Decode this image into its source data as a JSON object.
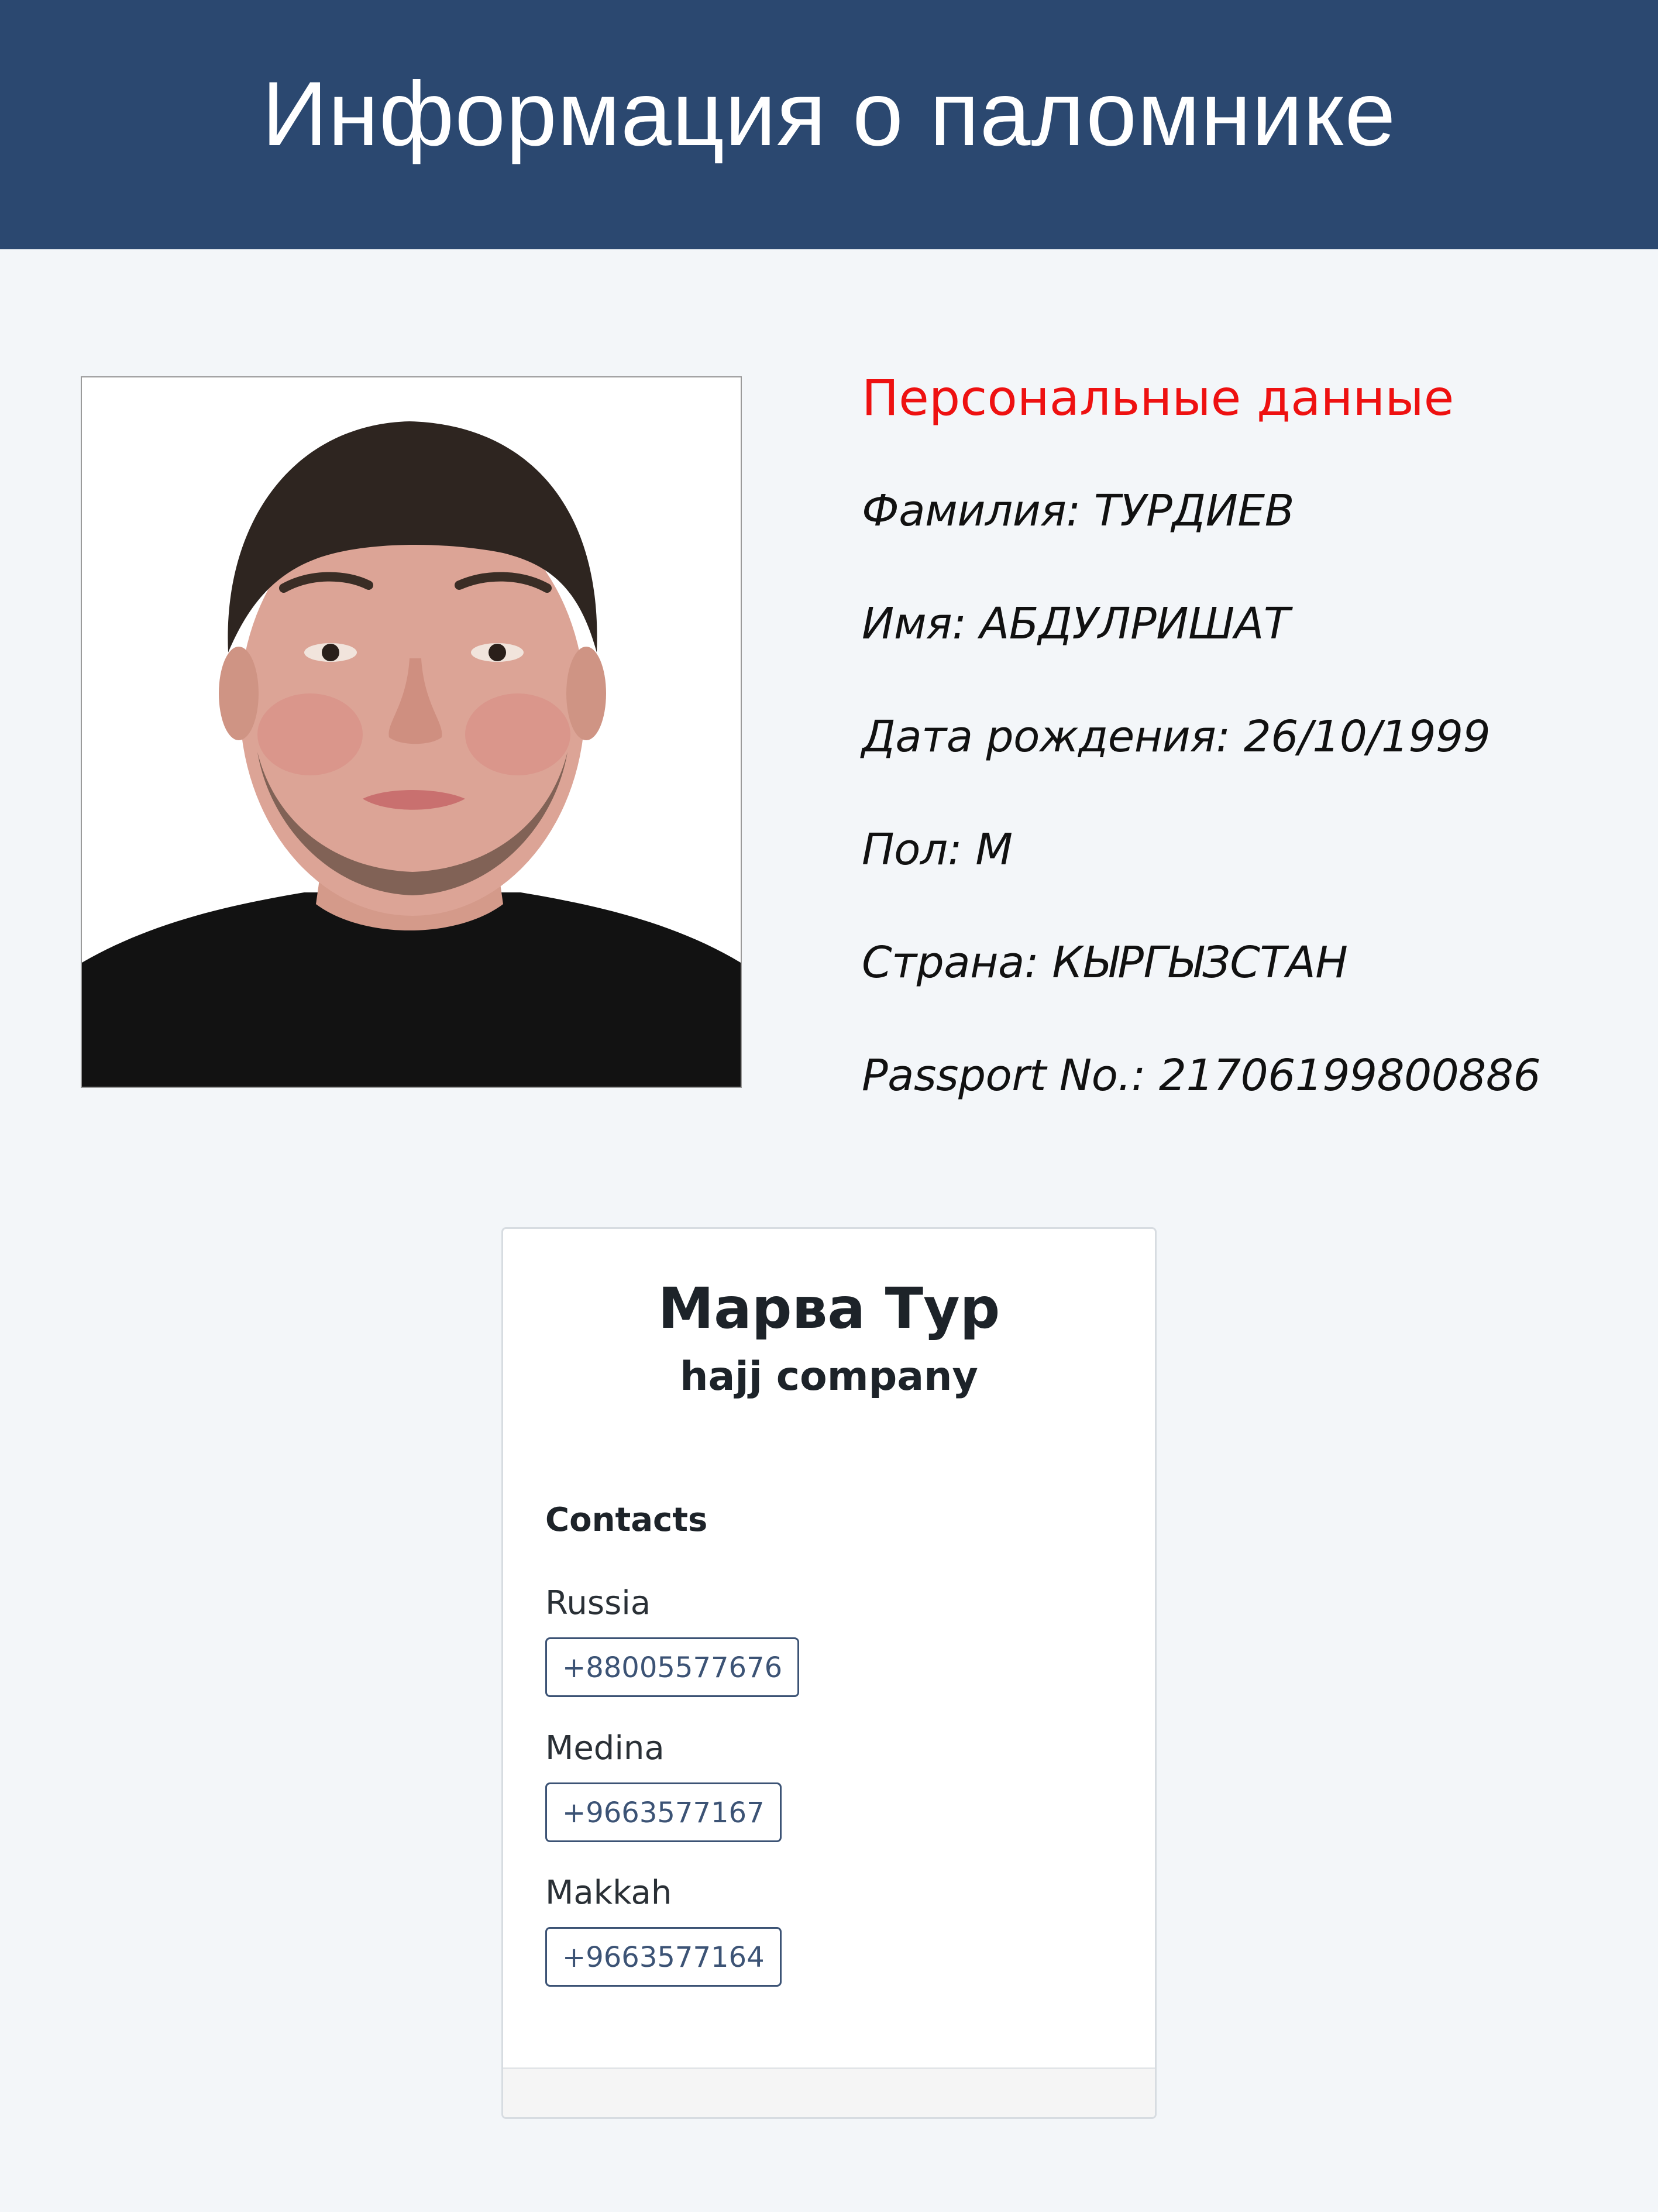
{
  "header": {
    "title": "Информация о паломнике"
  },
  "photo": {
    "alt_icon": "pilgrim-photo"
  },
  "personal": {
    "heading": "Персональные данные",
    "fields": [
      {
        "label": "Фамилия:",
        "value": "ТУРДИЕВ"
      },
      {
        "label": "Имя:",
        "value": "АБДУЛРИШАТ"
      },
      {
        "label": "Дата рождения:",
        "value": "26/10/1999"
      },
      {
        "label": "Пол:",
        "value": "M"
      },
      {
        "label": "Страна:",
        "value": "КЫРГЫЗСТАН"
      },
      {
        "label": "Passport No.:",
        "value": "21706199800886"
      }
    ]
  },
  "company": {
    "name": "Марва Тур",
    "subtitle": "hajj company",
    "contacts_heading": "Contacts",
    "contacts": [
      {
        "location": "Russia",
        "phone": "+88005577676"
      },
      {
        "location": "Medina",
        "phone": "+9663577167"
      },
      {
        "location": "Makkah",
        "phone": "+9663577164"
      }
    ]
  },
  "colors": {
    "header_bg": "#2b4870",
    "page_bg": "#f3f6f9",
    "heading_red": "#ee1111",
    "phone_border": "#3c5375"
  }
}
